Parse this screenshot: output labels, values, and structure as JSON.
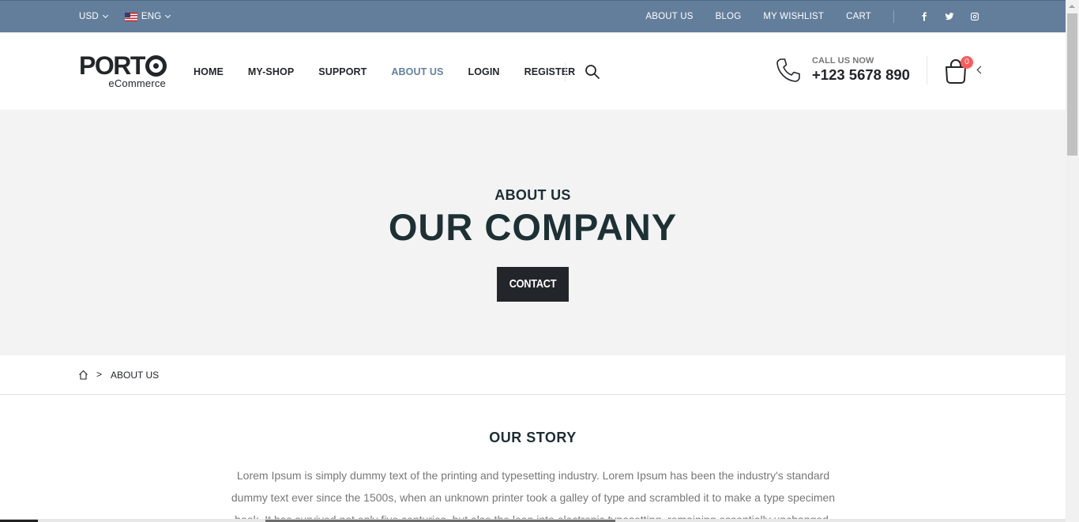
{
  "topbar": {
    "currency": "USD",
    "language": "ENG",
    "links": [
      "ABOUT US",
      "BLOG",
      "MY WISHLIST",
      "CART"
    ],
    "social": [
      "facebook-icon",
      "twitter-icon",
      "instagram-icon"
    ],
    "background": "#637e9b"
  },
  "header": {
    "logo_main": "PORT",
    "logo_sub": "eCommerce",
    "nav": [
      "HOME",
      "MY-SHOP",
      "SUPPORT",
      "ABOUT US",
      "LOGIN",
      "REGISTER"
    ],
    "active_nav": "ABOUT US",
    "call_label": "CALL US NOW",
    "phone": "+123 5678 890",
    "cart_count": "0",
    "accent": "#6380a0",
    "badge_color": "#ff5b5b"
  },
  "hero": {
    "subtitle": "ABOUT US",
    "title": "OUR COMPANY",
    "button": "CONTACT"
  },
  "breadcrumb": {
    "current": "ABOUT US"
  },
  "story": {
    "title": "OUR STORY",
    "text": "Lorem Ipsum is simply dummy text of the printing and typesetting industry. Lorem Ipsum has been the industry's standard dummy text ever since the 1500s, when an unknown printer took a galley of type and scrambled it to make a type specimen book. It has survived not only five centuries, but also the leap into electronic typesetting, remaining essentially unchanged."
  }
}
